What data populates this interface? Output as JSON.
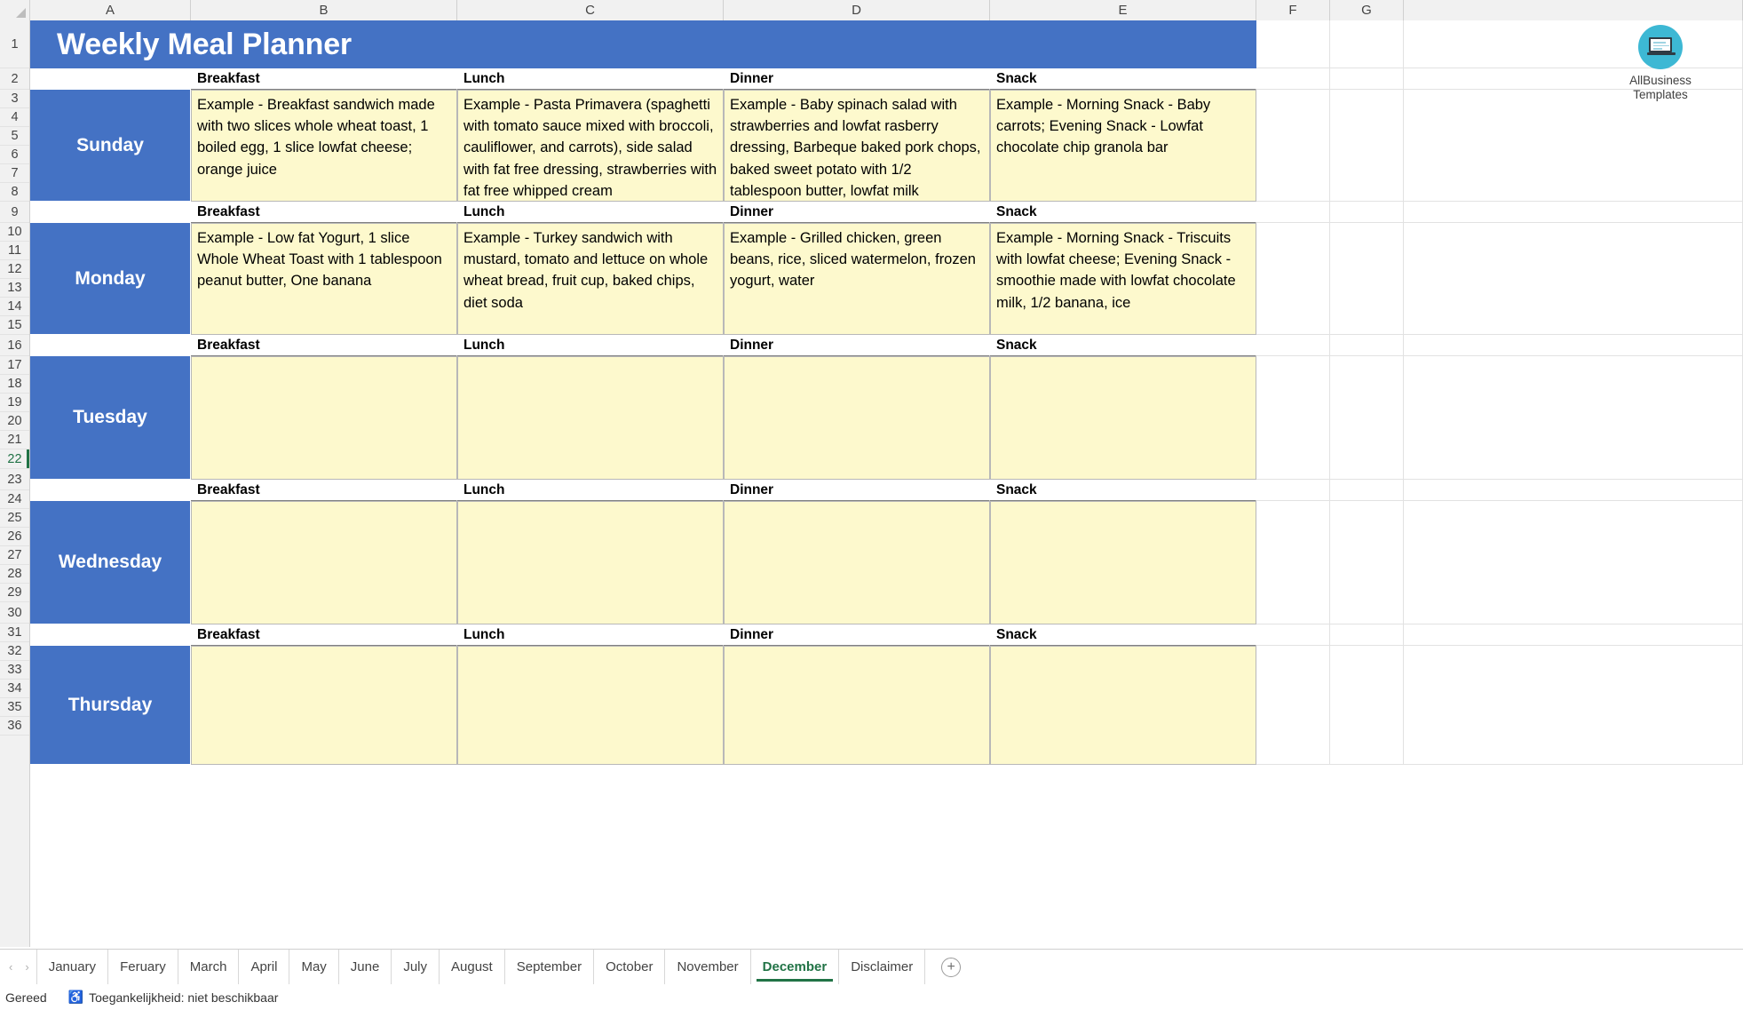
{
  "app": {
    "title_banner": "Weekly Meal Planner",
    "banner_color": "#4472c4",
    "cell_fill_color": "#fdf9cd",
    "accent_green": "#217346"
  },
  "grid": {
    "column_headers": [
      "A",
      "B",
      "C",
      "D",
      "E",
      "F",
      "G"
    ],
    "row_numbers": [
      "1",
      "2",
      "3",
      "4",
      "5",
      "6",
      "7",
      "8",
      "9",
      "10",
      "11",
      "12",
      "13",
      "14",
      "15",
      "16",
      "17",
      "18",
      "19",
      "20",
      "21",
      "22",
      "23",
      "24",
      "25",
      "26",
      "27",
      "28",
      "29",
      "30",
      "31",
      "32",
      "33",
      "34",
      "35",
      "36"
    ],
    "selected_row": "22"
  },
  "meal_headers": [
    "Breakfast",
    "Lunch",
    "Dinner",
    "Snack"
  ],
  "days": [
    {
      "name": "Sunday",
      "breakfast": "Example -  Breakfast sandwich made with two slices whole wheat toast, 1 boiled egg, 1 slice lowfat cheese; orange juice",
      "lunch": "Example - Pasta Primavera (spaghetti with tomato sauce mixed with broccoli, cauliflower, and carrots), side salad with fat free dressing, strawberries with fat free whipped cream",
      "dinner": "Example - Baby spinach salad with strawberries and lowfat rasberry dressing, Barbeque baked pork chops, baked sweet potato with 1/2 tablespoon butter, lowfat milk",
      "snack": "Example - Morning Snack - Baby carrots; Evening Snack - Lowfat chocolate chip granola bar"
    },
    {
      "name": "Monday",
      "breakfast": "Example - Low fat Yogurt, 1 slice Whole Wheat Toast with 1 tablespoon peanut butter, One banana",
      "lunch": "Example - Turkey sandwich with mustard, tomato and lettuce on whole wheat bread, fruit cup, baked chips, diet soda",
      "dinner": "Example - Grilled chicken, green beans, rice, sliced watermelon, frozen yogurt, water",
      "snack": "Example - Morning Snack - Triscuits with lowfat cheese; Evening Snack - smoothie made with lowfat chocolate milk, 1/2 banana, ice"
    },
    {
      "name": "Tuesday",
      "breakfast": "",
      "lunch": "",
      "dinner": "",
      "snack": ""
    },
    {
      "name": "Wednesday",
      "breakfast": "",
      "lunch": "",
      "dinner": "",
      "snack": ""
    },
    {
      "name": "Thursday",
      "breakfast": "",
      "lunch": "",
      "dinner": "",
      "snack": ""
    }
  ],
  "logo": {
    "line1": "AllBusiness",
    "line2": "Templates",
    "circle_color": "#3db8d4"
  },
  "sheet_tabs": {
    "items": [
      "January",
      "Feruary",
      "March",
      "April",
      "May",
      "June",
      "July",
      "August",
      "September",
      "October",
      "November",
      "December",
      "Disclaimer"
    ],
    "active": "December",
    "add_label": "+",
    "prev_arrow": "‹",
    "next_arrow": "›"
  },
  "status_bar": {
    "ready": "Gereed",
    "accessibility": "Toegankelijkheid: niet beschikbaar"
  }
}
